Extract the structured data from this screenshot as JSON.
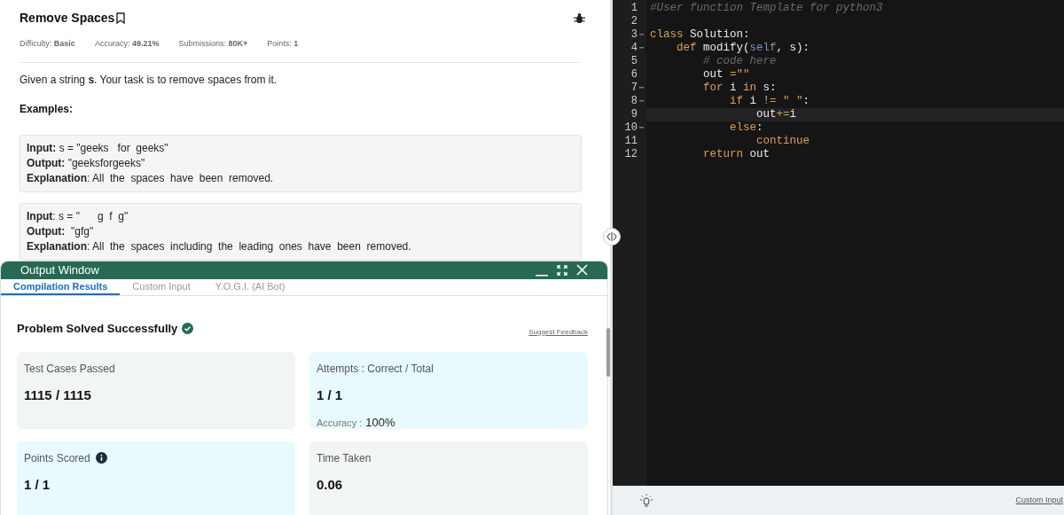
{
  "problem": {
    "title": "Remove Spaces",
    "meta": [
      "Difficulty: **Basic**",
      "Accuracy: **49.21%**",
      "Submissions: **80K+**",
      "Points: **1**"
    ],
    "statement": "Given a string **s**. Your task is to remove spaces from it.",
    "examples_heading": "Examples:",
    "examples": [
      [
        "**Input:** s = \"geeks   for  geeks\"",
        "**Output:** \"geeksforgeeks\"",
        "**Explanation**: All  the  spaces  have  been  removed."
      ],
      [
        "**Input**: s = \"      g  f  g\"",
        "**Output:**  \"gfg\"",
        "**Explanation**: All  the  spaces  including  the  leading  ones  have  been  removed."
      ]
    ]
  },
  "output_window": {
    "title": "Output Window",
    "tabs": [
      {
        "label": "Compilation Results",
        "selected": true
      },
      {
        "label": "Custom Input",
        "selected": false
      },
      {
        "label": "Y.O.G.I. (AI Bot)",
        "selected": false
      }
    ],
    "status": "Problem Solved Successfully",
    "feedback_link": "Suggest Feedback",
    "cards": [
      {
        "kind": "plain",
        "label": "Test Cases Passed",
        "value": "1115 / 1115",
        "info": false
      },
      {
        "kind": "accent",
        "label": "Attempts : Correct / Total",
        "value": "1 / 1",
        "note_label": "Accuracy :",
        "note_value": "100%",
        "info": false
      },
      {
        "kind": "accent",
        "label": "Points Scored",
        "value": "1 / 1",
        "info": true
      },
      {
        "kind": "plain",
        "label": "Time Taken",
        "value": "0.06",
        "info": false
      }
    ]
  },
  "editor": {
    "lines": [
      {
        "number": "1",
        "foldable": false,
        "current": false,
        "tokens": [
          {
            "kind": "comment",
            "text": "#User function Template for python3"
          }
        ]
      },
      {
        "number": "2",
        "foldable": false,
        "current": false
      },
      {
        "number": "3",
        "foldable": true,
        "current": false,
        "tokens": [
          {
            "kind": "keyword",
            "text": "class"
          },
          {
            "kind": "plain",
            "text": " Solution:"
          }
        ]
      },
      {
        "number": "4",
        "foldable": true,
        "current": false,
        "tokens": [
          {
            "kind": "keyword",
            "text": "    def"
          },
          {
            "kind": "plain",
            "text": " modify("
          },
          {
            "kind": "self",
            "text": "self"
          },
          {
            "kind": "plain",
            "text": ", s):"
          }
        ]
      },
      {
        "number": "5",
        "foldable": false,
        "current": false,
        "tokens": [
          {
            "kind": "comment",
            "text": "        # code here"
          }
        ]
      },
      {
        "number": "6",
        "foldable": false,
        "current": false,
        "tokens": [
          {
            "kind": "plain",
            "text": "        out "
          },
          {
            "kind": "operator",
            "text": "=\"\""
          }
        ]
      },
      {
        "number": "7",
        "foldable": true,
        "current": false,
        "tokens": [
          {
            "kind": "keyword",
            "text": "        for"
          },
          {
            "kind": "plain",
            "text": " i "
          },
          {
            "kind": "keyword",
            "text": "in"
          },
          {
            "kind": "plain",
            "text": " s:"
          }
        ]
      },
      {
        "number": "8",
        "foldable": true,
        "current": false,
        "tokens": [
          {
            "kind": "keyword",
            "text": "            if"
          },
          {
            "kind": "plain",
            "text": " i "
          },
          {
            "kind": "operator",
            "text": "!= \" \""
          },
          {
            "kind": "plain",
            "text": ":"
          }
        ]
      },
      {
        "number": "9",
        "foldable": false,
        "current": true,
        "tokens": [
          {
            "kind": "plain",
            "text": "                out"
          },
          {
            "kind": "operator",
            "text": "+="
          },
          {
            "kind": "plain",
            "text": "i"
          }
        ]
      },
      {
        "number": "10",
        "foldable": true,
        "current": false,
        "tokens": [
          {
            "kind": "keyword",
            "text": "            else"
          },
          {
            "kind": "plain",
            "text": ":"
          }
        ]
      },
      {
        "number": "11",
        "foldable": false,
        "current": false,
        "tokens": [
          {
            "kind": "keyword",
            "text": "                continue"
          }
        ]
      },
      {
        "number": "12",
        "foldable": false,
        "current": false,
        "tokens": [
          {
            "kind": "keyword",
            "text": "        return"
          },
          {
            "kind": "plain",
            "text": " out"
          }
        ]
      }
    ],
    "custom_input_link": "Custom Input"
  }
}
